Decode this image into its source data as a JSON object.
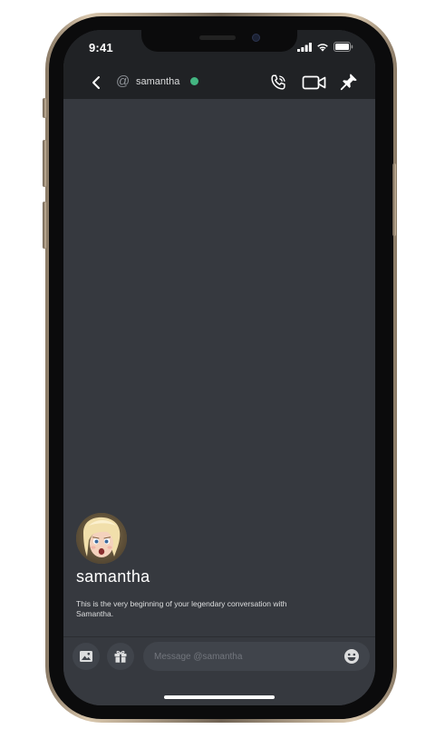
{
  "status_bar": {
    "time": "9:41"
  },
  "header": {
    "at_symbol": "@",
    "username": "samantha",
    "online_color": "#43b581",
    "icons": [
      "back-icon",
      "phone-icon",
      "video-icon",
      "pin-icon"
    ]
  },
  "welcome": {
    "name": "samantha",
    "intro": "This is the very beginning of your legendary conversation with Samantha."
  },
  "composer": {
    "placeholder": "Message @samantha",
    "icons": [
      "image-icon",
      "gift-icon",
      "emoji-icon"
    ]
  },
  "colors": {
    "background": "#36393f",
    "header": "#202225",
    "input": "#40444b"
  }
}
